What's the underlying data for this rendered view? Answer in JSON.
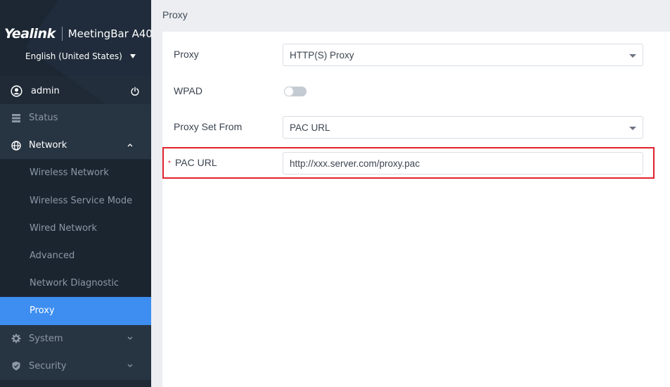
{
  "brand": {
    "logo_text": "Yealink",
    "product": "MeetingBar A40",
    "language": "English (United States)"
  },
  "user": {
    "name": "admin",
    "icon": "user-circle-icon",
    "power_icon": "power-icon"
  },
  "sidebar": {
    "items": [
      {
        "label": "Status",
        "icon": "status-icon"
      },
      {
        "label": "Network",
        "icon": "globe-icon",
        "expanded": true,
        "children": [
          {
            "label": "Wireless Network"
          },
          {
            "label": "Wireless Service Mode"
          },
          {
            "label": "Wired Network"
          },
          {
            "label": "Advanced"
          },
          {
            "label": "Network Diagnostic"
          },
          {
            "label": "Proxy",
            "active": true
          }
        ]
      },
      {
        "label": "System",
        "icon": "gear-icon"
      },
      {
        "label": "Security",
        "icon": "shield-icon"
      }
    ]
  },
  "page": {
    "title": "Proxy",
    "fields": {
      "proxy": {
        "label": "Proxy",
        "value": "HTTP(S) Proxy"
      },
      "wpad": {
        "label": "WPAD",
        "enabled": false
      },
      "proxy_set_from": {
        "label": "Proxy Set From",
        "value": "PAC URL"
      },
      "pac_url": {
        "required_mark": "*",
        "label": "PAC URL",
        "value": "http://xxx.server.com/proxy.pac"
      }
    }
  },
  "colors": {
    "sidebar_bg": "#1f2a36",
    "active_item": "#3d8ef0",
    "highlight_border": "#e0232e",
    "page_bg": "#eceef2"
  }
}
